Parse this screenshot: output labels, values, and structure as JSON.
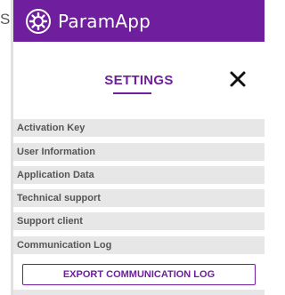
{
  "edge": {
    "letter": "S"
  },
  "header": {
    "app_name": "ParamApp",
    "logo_icon": "gear-cog-icon"
  },
  "settings": {
    "title": "SETTINGS",
    "close_icon": "close-icon",
    "items": [
      {
        "label": "Activation Key"
      },
      {
        "label": "User Information"
      },
      {
        "label": "Application Data"
      },
      {
        "label": "Technical support"
      },
      {
        "label": "Support client"
      },
      {
        "label": "Communication Log"
      }
    ],
    "export_label": "EXPORT COMMUNICATION LOG"
  },
  "colors": {
    "accent": "#6f1f9e",
    "row_background": "#e7e7e7",
    "row_text": "#555555",
    "page_background": "#ffffff"
  }
}
